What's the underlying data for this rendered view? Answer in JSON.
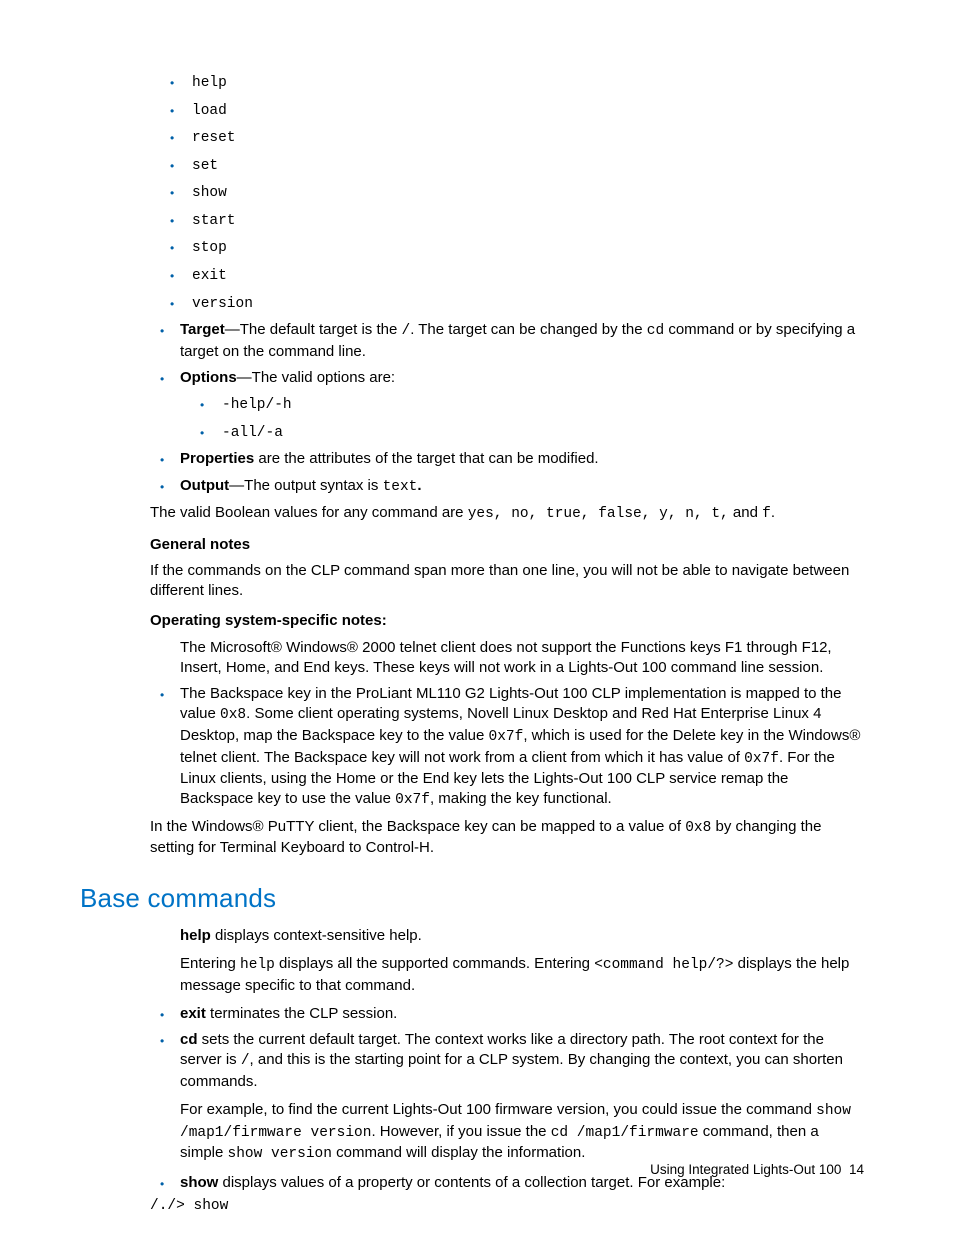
{
  "verbs": [
    "help",
    "load",
    "reset",
    "set",
    "show",
    "start",
    "stop",
    "exit",
    "version"
  ],
  "target": {
    "label": "Target",
    "text_a": "—The default target is the ",
    "slash": "/",
    "text_b": ". The target can be changed by the ",
    "cd": "cd",
    "text_c": " command or by specifying a target on the command line."
  },
  "options": {
    "label": "Options",
    "text": "—The valid options are:",
    "items": [
      "-help/-h",
      "-all/-a"
    ]
  },
  "properties": {
    "label": "Properties",
    "text": " are the attributes of the target that can be modified."
  },
  "output": {
    "label": "Output",
    "text_a": "—The output syntax is ",
    "code": "text",
    "dot": "."
  },
  "bool_sentence": {
    "a": "The valid Boolean values for any command are ",
    "codes": "yes, no, true, false, y, n, t,",
    "mid": " and ",
    "last": "f",
    "dot": "."
  },
  "general_notes": {
    "heading": "General notes",
    "body": "If the commands on the CLP command span more than one line, you will not be able to navigate between different lines."
  },
  "os_notes": {
    "heading": "Operating system-specific notes:",
    "item1": "The Microsoft® Windows® 2000 telnet client does not support the Functions keys F1 through F12, Insert, Home, and End keys. These keys will not work in a Lights-Out 100 command line session.",
    "item2": {
      "a": "The Backspace key in the ProLiant ML110 G2 Lights-Out 100 CLP implementation is mapped to the value ",
      "c1": "0x8",
      "b": ". Some client operating systems, Novell Linux Desktop and Red Hat Enterprise Linux 4 Desktop, map the Backspace key to the value ",
      "c2": "0x7f",
      "c": ", which is used for the Delete key in the Windows® telnet client. The Backspace key will not work from a client from which it has value of ",
      "c3": "0x7f",
      "d": ". For the Linux clients, using the Home or the End key lets the Lights-Out 100 CLP service remap the Backspace key to use the value ",
      "c4": "0x7f",
      "e": ", making the key functional."
    },
    "putty": {
      "a": "In the Windows® PuTTY client, the Backspace key can be mapped to a value of ",
      "c": "0x8",
      "b": " by changing the setting for Terminal Keyboard to Control-H."
    }
  },
  "base": {
    "heading": "Base commands",
    "help": {
      "label": "help",
      "text": " displays context-sensitive help.",
      "p2a": "Entering ",
      "c1": "help",
      "p2b": " displays all the supported commands. Entering ",
      "c2": "<command help/?>",
      "p2c": " displays the help message specific to that command."
    },
    "exit": {
      "label": "exit",
      "text": " terminates the CLP session."
    },
    "cd": {
      "label": "cd",
      "a": " sets the current default target. The context works like a directory path. The root context for the server is ",
      "slash": "/",
      "b": ", and this is the starting point for a CLP system. By changing the context, you can shorten commands.",
      "p2a": "For example, to find the current Lights-Out 100 firmware version, you could issue the command ",
      "c1": "show /map1/firmware version",
      "p2b": ". However, if you issue the ",
      "c2": "cd /map1/firmware",
      "p2c": " command, then a simple ",
      "c3": "show version",
      "p2d": " command will display the information."
    },
    "show": {
      "label": "show",
      "text": " displays values of a property or contents of a collection target. For example:"
    },
    "prompt": "/./> show"
  },
  "footer": {
    "text": "Using Integrated Lights-Out 100",
    "page": "14"
  }
}
